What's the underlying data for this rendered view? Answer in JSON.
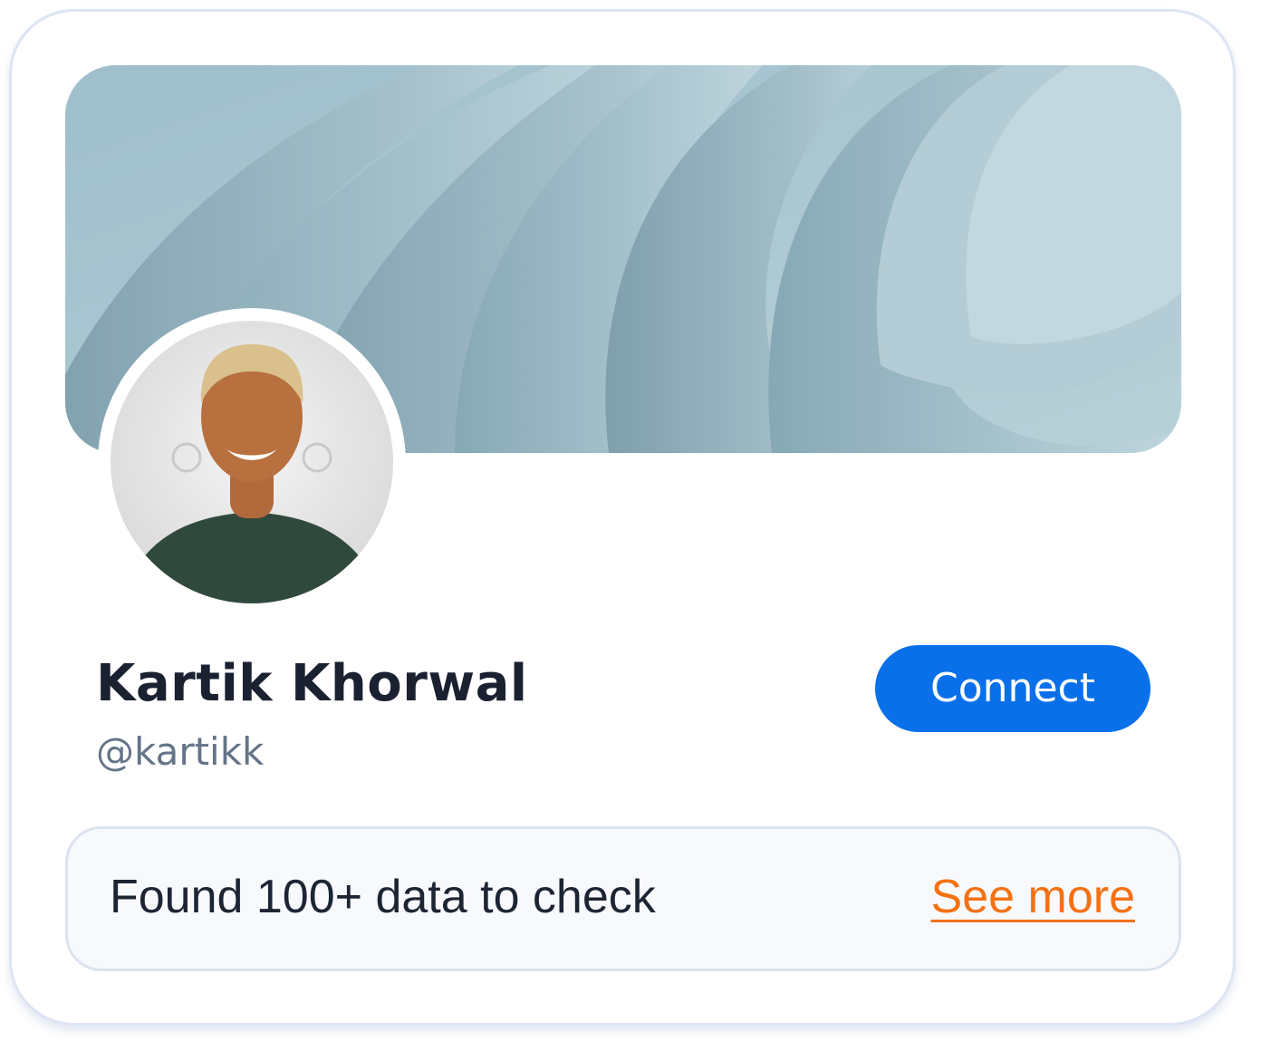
{
  "profile": {
    "name": "Kartik Khorwal",
    "handle": "@kartikk",
    "connect_label": "Connect"
  },
  "summary": {
    "text": "Found 100+ data to check",
    "link_label": "See more"
  },
  "colors": {
    "accent": "#0a70ea",
    "link": "#f47113",
    "cover": "#a9c3cd"
  }
}
